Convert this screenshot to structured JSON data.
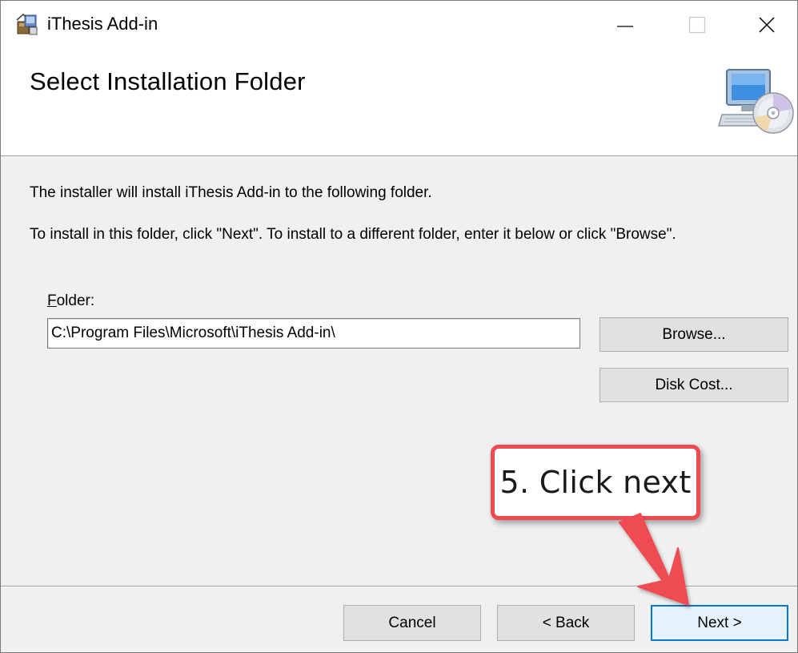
{
  "window": {
    "title": "iThesis Add-in",
    "icon": "installer-package-icon"
  },
  "titlebar_buttons": {
    "minimize_icon": "minimize-icon",
    "maximize_icon": "maximize-icon",
    "close_icon": "close-icon"
  },
  "header": {
    "title": "Select Installation Folder",
    "icon": "computer-disc-icon"
  },
  "body": {
    "description_1": "The installer will install iThesis Add-in to the following folder.",
    "description_2": "To install in this folder, click \"Next\". To install to a different folder, enter it below or click \"Browse\".",
    "folder_label_accel": "F",
    "folder_label_rest": "older:",
    "folder_value": "C:\\Program Files\\Microsoft\\iThesis Add-in\\",
    "browse_label": "Browse...",
    "disk_cost_label": "Disk Cost..."
  },
  "footer": {
    "cancel_label": "Cancel",
    "back_label": "< Back",
    "next_label": "Next >"
  },
  "annotation": {
    "text": "5. Click next",
    "color": "#ee4b52"
  },
  "colors": {
    "accent": "#0078d7",
    "dialog_bg": "#f0f0f0",
    "button_bg": "#e1e1e1"
  }
}
